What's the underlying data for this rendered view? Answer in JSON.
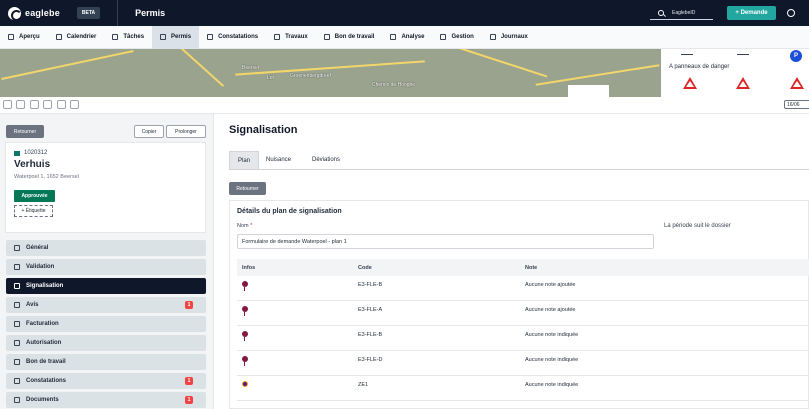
{
  "app": {
    "logo_text": "eaglebe",
    "beta": "BETA",
    "module": "Permis",
    "search_value": "EaglebeID",
    "new_button": "+ Demande"
  },
  "nav": {
    "tabs": [
      {
        "label": "Aperçu"
      },
      {
        "label": "Calendrier"
      },
      {
        "label": "Tâches"
      },
      {
        "label": "Permis"
      },
      {
        "label": "Constatations"
      },
      {
        "label": "Travaux"
      },
      {
        "label": "Bon de travail"
      },
      {
        "label": "Analyse"
      },
      {
        "label": "Gestion"
      },
      {
        "label": "Journaux"
      }
    ]
  },
  "map": {
    "labels": [
      "Beersel",
      "Lot",
      "Groenenbergdreef",
      "Chemin de Hooghe"
    ],
    "panel_text": "A panneaux de danger",
    "date": "16/06"
  },
  "left": {
    "return": "Retourner",
    "copy": "Copier",
    "extend": "Prolonger",
    "permit_id": "1020312",
    "title": "Verhuis",
    "address": "Waterpoel 1, 1652 Beersel",
    "status": "Approuvée",
    "label_button": "+ Étiquette",
    "items": [
      {
        "label": "Général",
        "count": ""
      },
      {
        "label": "Validation",
        "count": ""
      },
      {
        "label": "Signalisation",
        "count": ""
      },
      {
        "label": "Avis",
        "count": "1"
      },
      {
        "label": "Facturation",
        "count": ""
      },
      {
        "label": "Autorisation",
        "count": ""
      },
      {
        "label": "Bon de travail",
        "count": ""
      },
      {
        "label": "Constatations",
        "count": "1"
      },
      {
        "label": "Documents",
        "count": "1"
      }
    ]
  },
  "main": {
    "title": "Signalisation",
    "tabs": [
      "Plan",
      "Nuisance",
      "Déviations"
    ],
    "return": "Retourner",
    "heading": "Détails du plan de signalisation",
    "name_label": "Nom",
    "required": "*",
    "period_note": "La période suit le dossier",
    "name_value": "Formulaire de demande Waterpoel - plan 1",
    "columns": [
      "Infos",
      "Code",
      "Note"
    ],
    "rows": [
      {
        "code": "E3-FLE-B",
        "note": "Aucune note ajoutée"
      },
      {
        "code": "E3-FLE-A",
        "note": "Aucune note ajoutée"
      },
      {
        "code": "E3-FLE-B",
        "note": "Aucune note indiquée"
      },
      {
        "code": "E3-FLE-D",
        "note": "Aucune note indiquée"
      },
      {
        "code": "ZE1",
        "note": "Aucune note indiquée"
      }
    ]
  }
}
